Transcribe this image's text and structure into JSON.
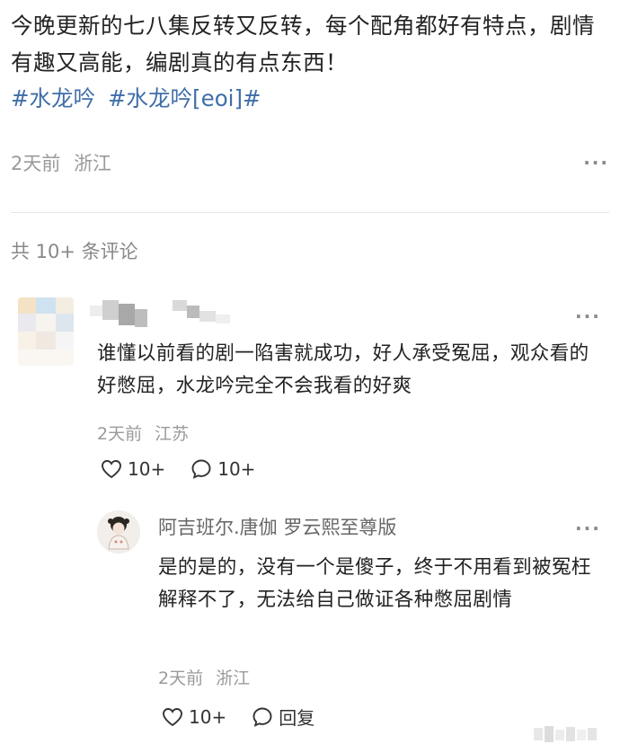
{
  "post": {
    "text": "今晚更新的七八集反转又反转，每个配角都好有特点，剧情有趣又高能，编剧真的有点东西！",
    "tags": [
      "#水龙吟",
      "#水龙吟[eoi]#"
    ],
    "time": "2天前",
    "location": "浙江"
  },
  "comments_header": "共 10+ 条评论",
  "comment": {
    "text": "谁懂以前看的剧一陷害就成功，好人承受冤屈，观众看的好憋屈，水龙吟完全不会我看的好爽",
    "time": "2天前",
    "location": "江苏",
    "likes": "10+",
    "replies": "10+"
  },
  "reply": {
    "author": "阿吉班尔.唐伽 罗云熙至尊版",
    "text": "是的是的，没有一个是傻子，终于不用看到被冤枉解释不了，无法给自己做证各种憋屈剧情",
    "time": "2天前",
    "location": "浙江",
    "likes": "10+",
    "reply_label": "回复"
  },
  "more_label": "···",
  "icons": {
    "heart": "heart-icon",
    "comment": "comment-bubble-icon",
    "more": "more-dots-icon"
  },
  "colors": {
    "tag": "#3f6ea8",
    "meta": "#9a9a9a"
  }
}
